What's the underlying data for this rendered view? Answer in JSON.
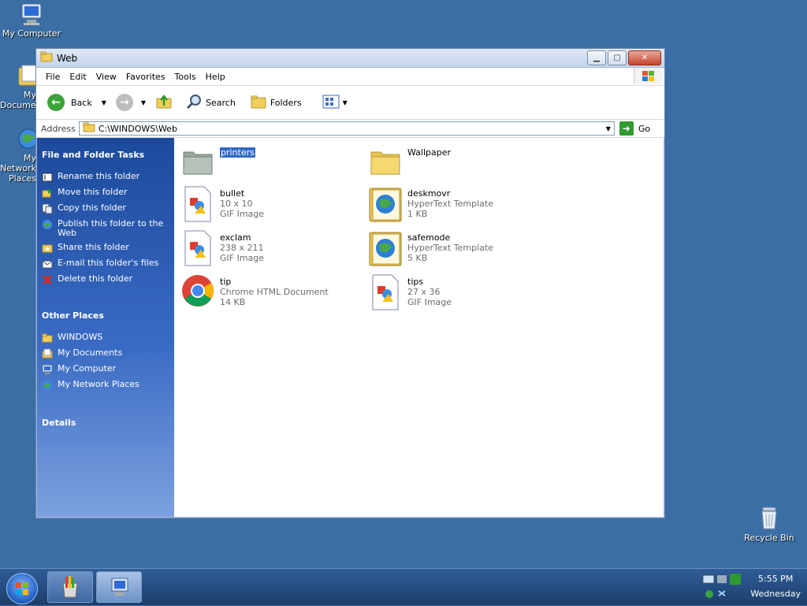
{
  "desktop": {
    "icons": [
      {
        "label": "My Computer"
      },
      {
        "label": "My Documents"
      },
      {
        "label": "My Network Places"
      },
      {
        "label": "Recycle Bin"
      }
    ]
  },
  "window": {
    "title": "Web",
    "menu": [
      "File",
      "Edit",
      "View",
      "Favorites",
      "Tools",
      "Help"
    ],
    "toolbar": {
      "back": "Back",
      "search": "Search",
      "folders": "Folders"
    },
    "address": {
      "label": "Address",
      "value": "C:\\WINDOWS\\Web",
      "go": "Go"
    },
    "sidebar": {
      "tasks_title": "File and Folder Tasks",
      "tasks": [
        "Rename this folder",
        "Move this folder",
        "Copy this folder",
        "Publish this folder to the Web",
        "Share this folder",
        "E-mail this folder's files",
        "Delete this folder"
      ],
      "other_title": "Other Places",
      "other": [
        "WINDOWS",
        "My Documents",
        "My Computer",
        "My Network Places"
      ],
      "details_title": "Details"
    },
    "files": [
      {
        "name": "printers",
        "line1": "",
        "line2": "",
        "icon": "folder-special-icon",
        "selected": true
      },
      {
        "name": "Wallpaper",
        "line1": "",
        "line2": "",
        "icon": "folder-icon"
      },
      {
        "name": "bullet",
        "line1": "10 x 10",
        "line2": "GIF Image",
        "icon": "image-file-icon"
      },
      {
        "name": "deskmovr",
        "line1": "HyperText Template",
        "line2": "1 KB",
        "icon": "htt-file-icon"
      },
      {
        "name": "exclam",
        "line1": "238 x 211",
        "line2": "GIF Image",
        "icon": "image-file-icon"
      },
      {
        "name": "safemode",
        "line1": "HyperText Template",
        "line2": "5 KB",
        "icon": "htt-file-icon"
      },
      {
        "name": "tip",
        "line1": "Chrome HTML Document",
        "line2": "14 KB",
        "icon": "chrome-icon"
      },
      {
        "name": "tips",
        "line1": "27 x 36",
        "line2": "GIF Image",
        "icon": "image-file-icon"
      }
    ]
  },
  "taskbar": {
    "time": "5:55 PM",
    "day": "Wednesday"
  }
}
